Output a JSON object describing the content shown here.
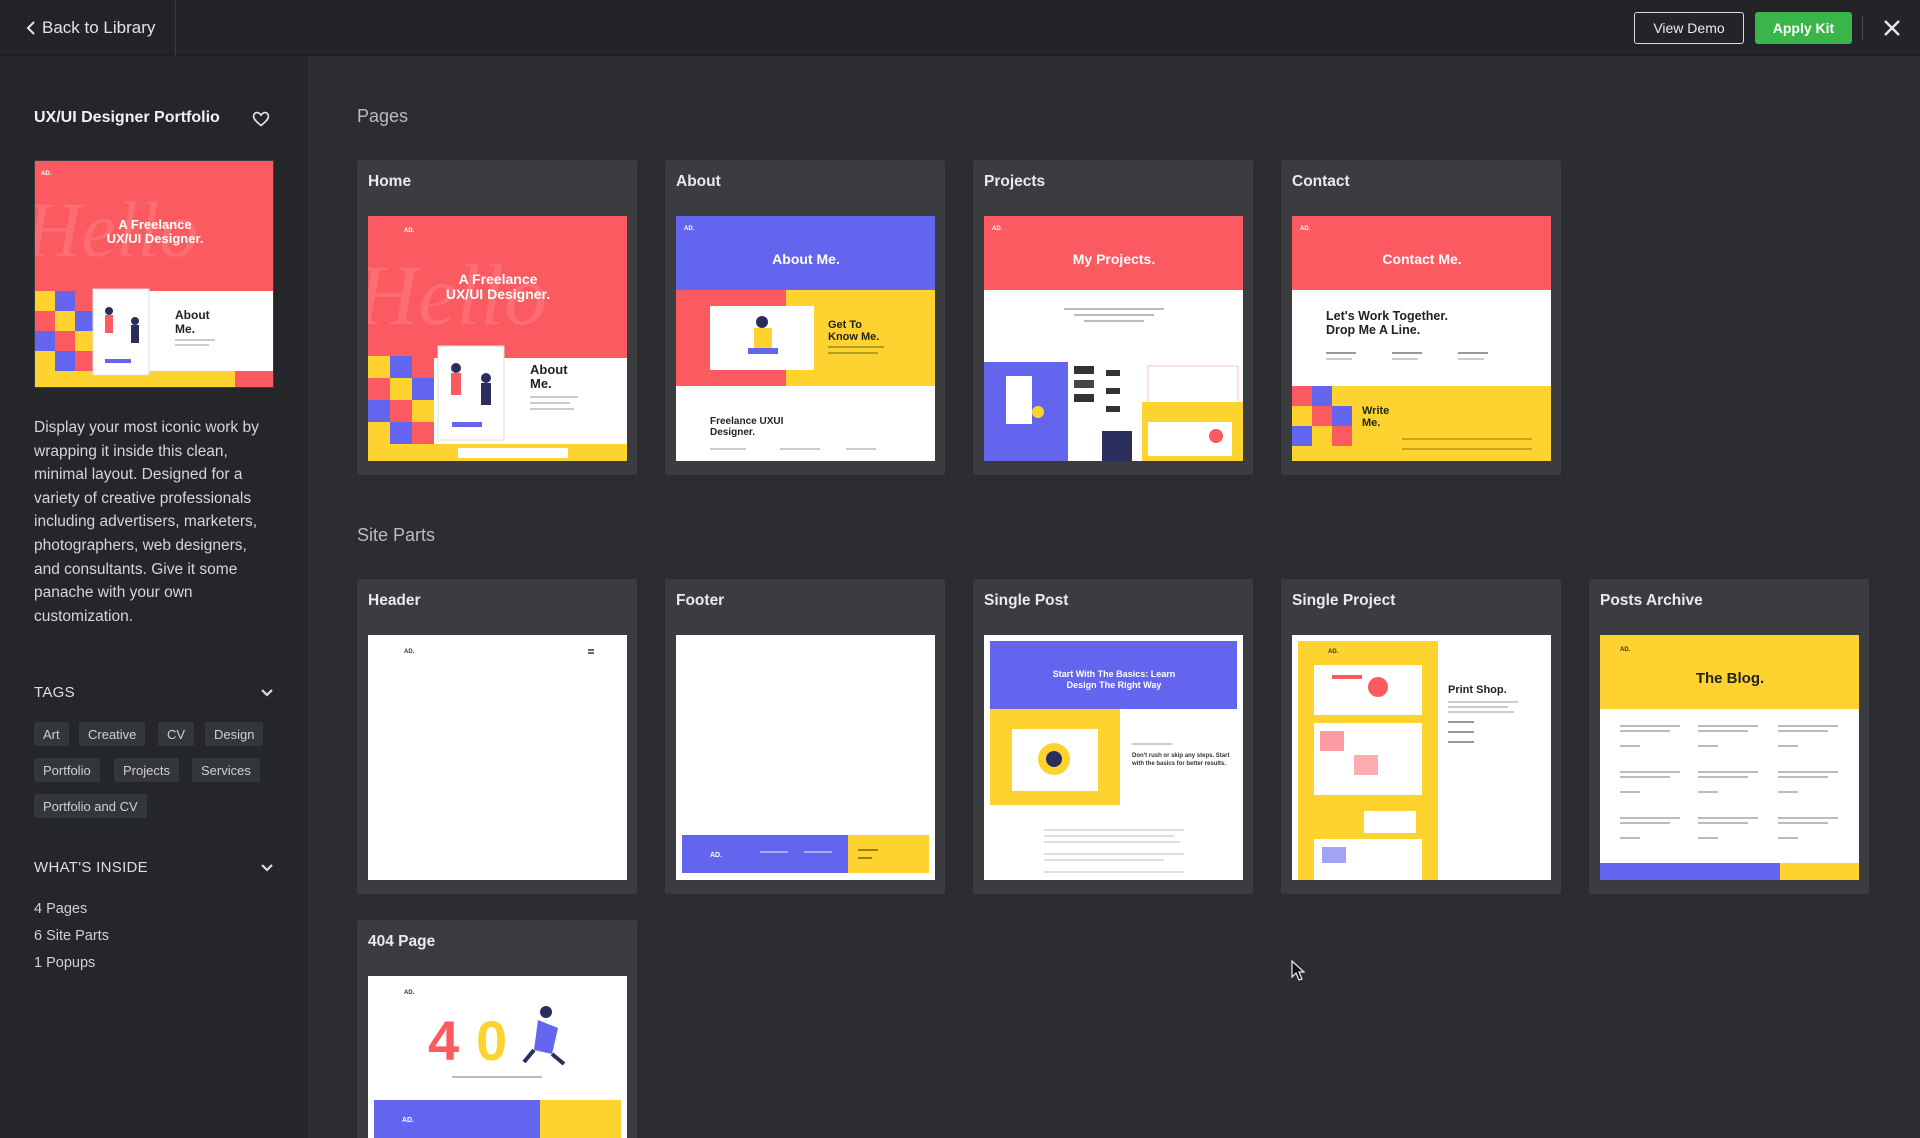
{
  "topbar": {
    "back_label": "Back to Library",
    "view_demo_label": "View Demo",
    "apply_label": "Apply Kit",
    "colors": {
      "apply": "#39b54a"
    }
  },
  "sidebar": {
    "kit_title": "UX/UI Designer Portfolio",
    "description": "Display your most iconic work by wrapping it inside this clean, minimal layout. Designed for a variety of creative professionals including advertisers, marketers, photographers, web designers, and consultants. Give it some panache with your own customization.",
    "tags_title": "TAGS",
    "tags": [
      "Art",
      "Creative",
      "CV",
      "Design",
      "Portfolio",
      "Projects",
      "Services",
      "Portfolio and CV"
    ],
    "inside_title": "WHAT'S INSIDE",
    "inside": [
      "4 Pages",
      "6 Site Parts",
      "1 Popups"
    ]
  },
  "main": {
    "pages_title": "Pages",
    "pages": [
      {
        "label": "Home",
        "preview": "home"
      },
      {
        "label": "About",
        "preview": "about"
      },
      {
        "label": "Projects",
        "preview": "projects"
      },
      {
        "label": "Contact",
        "preview": "contact"
      }
    ],
    "parts_title": "Site Parts",
    "parts": [
      {
        "label": "Header",
        "preview": "header"
      },
      {
        "label": "Footer",
        "preview": "footer"
      },
      {
        "label": "Single Post",
        "preview": "single-post"
      },
      {
        "label": "Single Project",
        "preview": "single-project"
      },
      {
        "label": "Posts Archive",
        "preview": "posts-archive"
      },
      {
        "label": "404 Page",
        "preview": "404"
      }
    ]
  },
  "previews": {
    "home": {
      "line1": "A Freelance",
      "line2": "UX/UI Designer.",
      "about": "About",
      "about2": "Me."
    },
    "about": {
      "title": "About Me.",
      "get1": "Get To",
      "get2": "Know Me.",
      "bottom1": "Freelance UXUI",
      "bottom2": "Designer."
    },
    "projects": {
      "title": "My Projects."
    },
    "contact": {
      "title": "Contact Me.",
      "line1": "Let's Work Together.",
      "line2": "Drop Me A Line.",
      "write1": "Write",
      "write2": "Me."
    },
    "single_post": {
      "title1": "Start With The Basics: Learn",
      "title2": "Design The Right Way",
      "sub1": "Don't rush or skip any steps. Start",
      "sub2": "with the basics for better results."
    },
    "single_project": {
      "title": "Print Shop."
    },
    "posts_archive": {
      "title": "The Blog."
    },
    "logo": "AD.",
    "e404": {
      "four": "4",
      "zero": "0"
    },
    "colors": {
      "red": "#fb5a61",
      "blue": "#6465ef",
      "yellow": "#fed32f",
      "navy": "#2b2e5c"
    }
  }
}
